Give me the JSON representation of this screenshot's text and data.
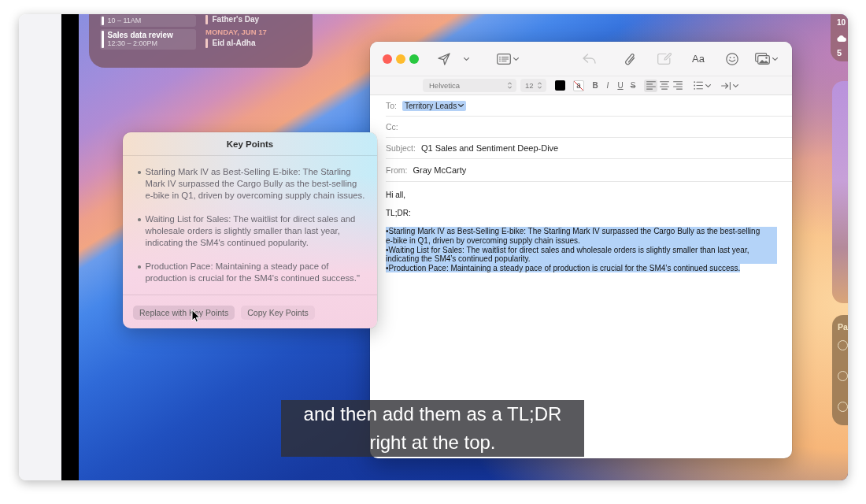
{
  "calendar_widget": {
    "events": [
      {
        "time": "10 – 11AM"
      },
      {
        "title": "Sales data review",
        "time": "12:30 – 2:00PM"
      }
    ],
    "agenda": [
      {
        "kind": "event",
        "title": "Father's Day"
      },
      {
        "kind": "date",
        "title": "MONDAY, JUN 17"
      },
      {
        "kind": "event",
        "title": "Eid al-Adha"
      }
    ]
  },
  "weather_widget": {
    "lines": [
      "10",
      "5"
    ]
  },
  "list_widget": {
    "title": "Pa",
    "items": [
      {
        "checked": false
      },
      {
        "checked": false
      },
      {
        "checked": false
      }
    ]
  },
  "mail_window": {
    "toolbar": [
      {
        "kind": "send",
        "disabled": false
      },
      {
        "kind": "send_menu",
        "disabled": false
      },
      {
        "kind": "header_fields",
        "disabled": false
      },
      {
        "kind": "reply",
        "disabled": true
      },
      {
        "kind": "attach",
        "disabled": false
      },
      {
        "kind": "markup",
        "disabled": true
      },
      {
        "kind": "format",
        "label": "Aa",
        "disabled": false
      },
      {
        "kind": "emoji",
        "disabled": false
      },
      {
        "kind": "photos",
        "disabled": false
      }
    ],
    "format_bar": {
      "font": "Helvetica",
      "size": "12",
      "highlight": "a",
      "styles": [
        {
          "kind": "bold",
          "label": "B"
        },
        {
          "kind": "italic",
          "label": "I"
        },
        {
          "kind": "underline",
          "label": "U"
        },
        {
          "kind": "strike",
          "label": "S"
        }
      ],
      "alignment": [
        {
          "kind": "left",
          "selected": true
        },
        {
          "kind": "center",
          "selected": false
        },
        {
          "kind": "right",
          "selected": false
        }
      ]
    },
    "fields": [
      {
        "kind": "to",
        "label": "To:",
        "recipients": [
          {
            "name": "Territory Leads",
            "selected": true
          }
        ]
      },
      {
        "kind": "cc",
        "label": "Cc:"
      },
      {
        "kind": "subject",
        "label": "Subject:",
        "value": "Q1 Sales and Sentiment Deep-Dive"
      },
      {
        "kind": "from",
        "label": "From:",
        "value": "Gray McCarty"
      }
    ],
    "body": [
      {
        "text": "Hi all,",
        "selected": false
      },
      {
        "text": "TL;DR:",
        "selected": false
      },
      {
        "text": "•Starling Mark IV as Best-Selling E-bike: The Starling Mark IV surpassed the Cargo Bully as the best-selling e-bike in Q1, driven by overcoming supply chain issues.",
        "selected": true
      },
      {
        "text": "•Waiting List for Sales: The waitlist for direct sales and wholesale orders is slightly smaller than last year, indicating the SM4’s continued popularity.",
        "selected": true
      },
      {
        "text": "•Production Pace: Maintaining a steady pace of production is crucial for the SM4’s continued success.",
        "selected": true
      }
    ]
  },
  "key_points": {
    "title": "Key Points",
    "points": [
      "Starling Mark IV as Best-Selling E-bike: The Starling Mark IV surpassed the Cargo Bully as the best-selling e-bike in Q1, driven by overcoming supply chain issues.",
      "Waiting List for Sales: The waitlist for direct sales and wholesale orders is slightly smaller than last year, indicating the SM4's continued popularity.",
      "Production Pace: Maintaining a steady pace of production is crucial for the SM4's continued success.\""
    ],
    "actions": [
      {
        "label": "Replace with Key Points",
        "hovered": true
      },
      {
        "label": "Copy Key Points",
        "hovered": false
      }
    ]
  },
  "caption": {
    "lines": [
      "and then add them as a TL;DR",
      "right at the top."
    ]
  }
}
